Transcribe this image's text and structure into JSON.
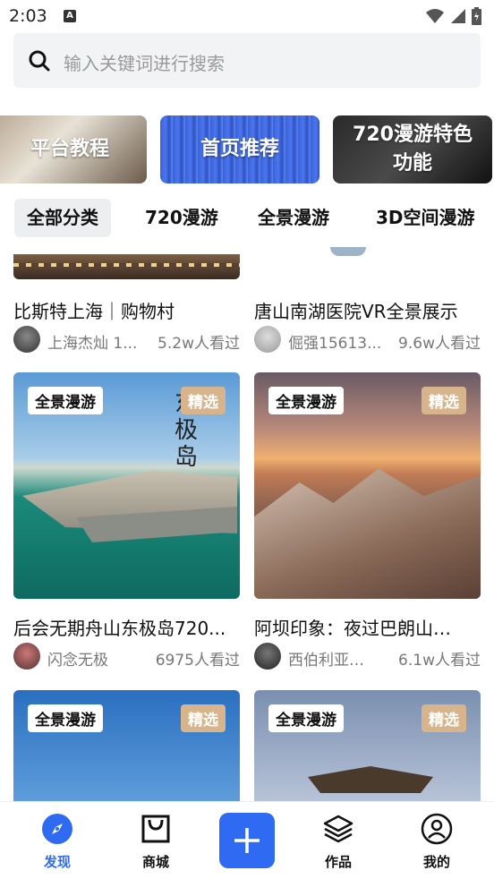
{
  "status_bar": {
    "time": "2:03",
    "a_badge": "A"
  },
  "search": {
    "placeholder": "输入关键词进行搜索"
  },
  "banners": [
    {
      "label": "平台教程"
    },
    {
      "label": "首页推荐"
    },
    {
      "label": "720漫游特色功能"
    }
  ],
  "tabs": [
    "全部分类",
    "720漫游",
    "全景漫游",
    "3D空间漫游"
  ],
  "cards_top": [
    {
      "title": "比斯特上海｜购物村",
      "author": "上海杰灿 1...",
      "views": "5.2w人看过"
    },
    {
      "title": "唐山南湖医院VR全景展示",
      "author": "倔强15613...",
      "views": "9.6w人看过"
    }
  ],
  "cards_mid": [
    {
      "tag": "全景漫游",
      "badge": "精选",
      "title": "后会无期舟山东极岛720...",
      "author": "闪念无极",
      "views": "6975人看过",
      "overlay_text": "东极岛"
    },
    {
      "tag": "全景漫游",
      "badge": "精选",
      "title": "阿坝印象：夜过巴朗山…",
      "author": "西伯利亚…",
      "views": "6.1w人看过"
    }
  ],
  "cards_bottom": [
    {
      "tag": "全景漫游",
      "badge": "精选"
    },
    {
      "tag": "全景漫游",
      "badge": "精选"
    }
  ],
  "bottom_nav": [
    {
      "label": "发现",
      "icon": "compass-icon",
      "active": true
    },
    {
      "label": "商城",
      "icon": "shopping-bag-icon",
      "active": false
    },
    {
      "label": "",
      "icon": "plus-icon",
      "active": false
    },
    {
      "label": "作品",
      "icon": "layers-icon",
      "active": false
    },
    {
      "label": "我的",
      "icon": "user-circle-icon",
      "active": false
    }
  ],
  "colors": {
    "accent": "#2f6bf2",
    "badge": "#d7b48c"
  }
}
